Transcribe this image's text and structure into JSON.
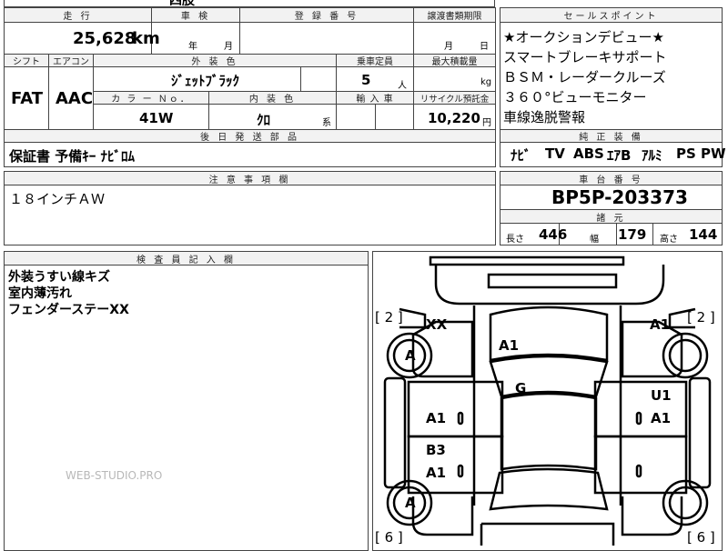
{
  "headers": {
    "mileage": "走 行",
    "inspection": "車 検",
    "registration": "登 録 番 号",
    "transfer_deadline": "譲渡書類期限",
    "sales_points": "セールスポイント",
    "shift": "シフト",
    "aircon": "エアコン",
    "exterior_color": "外 装 色",
    "capacity": "乗車定員",
    "max_load": "最大積載量",
    "color_no": "カ ラ ー Ｎｏ．",
    "interior_color": "内 装 色",
    "import": "輸 入 車",
    "recycle": "リサイクル預託金",
    "later_parts": "後 日 発 送 部 品",
    "genuine_equipment": "純 正 装 備",
    "notes": "注 意 事 項 欄",
    "chassis_no": "車 台 番 号",
    "specs": "諸 元",
    "inspector": "検 査 員 記 入 欄"
  },
  "top_partial": "四肢",
  "values": {
    "mileage": "25,628",
    "mileage_unit": "km",
    "year_label": "年",
    "month_label": "月",
    "transfer_month": "月",
    "transfer_day": "日",
    "shift": "FAT",
    "aircon": "AAC",
    "exterior_color": "ｼﾞｪｯﾄﾌﾞﾗｯｸ",
    "capacity": "5",
    "capacity_unit": "人",
    "load_unit": "kg",
    "color_no": "41W",
    "interior_color": "ｸﾛ",
    "interior_suffix": "系",
    "recycle": "10,220",
    "recycle_unit": "円",
    "later_parts": "保証書 予備ｷｰ ﾅﾋﾞﾛﾑ",
    "notes": "１８インチＡＷ",
    "chassis_no": "BP5P-203373"
  },
  "sales_points": [
    "★オークションデビュー★",
    "スマートブレーキサポート",
    "ＢＳＭ・レーダークルーズ",
    "３６０°ビューモニター",
    "車線逸脱警報"
  ],
  "equipment": [
    "ﾅﾋﾞ",
    "TV",
    "ABS",
    "ｴｱB",
    "ｱﾙﾐ",
    "PS",
    "PW"
  ],
  "dimensions": {
    "length_label": "長さ",
    "length": "446",
    "width_label": "幅",
    "width": "179",
    "height_label": "高さ",
    "height": "144"
  },
  "inspector_notes": [
    "外装うすい線キズ",
    "室内薄汚れ",
    "フェンダーステーXX"
  ],
  "watermark": "WEB-STUDIO.PRO",
  "diagram": {
    "bracket_tl": "[ 2 ]",
    "bracket_tr": "[ 2 ]",
    "bracket_bl": "[ 6 ]",
    "bracket_br": "[ 6 ]",
    "marks": {
      "front_left_fender": "XX",
      "hood": "A1",
      "front_right_fender": "A1",
      "front_left_wheel": "A",
      "front_right_wheel": "A1",
      "roof": "G",
      "right_front_door_upper": "U1",
      "left_front_door": "A1",
      "right_front_door": "A1",
      "left_rear_door_upper": "B3",
      "left_rear_door": "A1",
      "rear_left_wheel": "A"
    }
  }
}
